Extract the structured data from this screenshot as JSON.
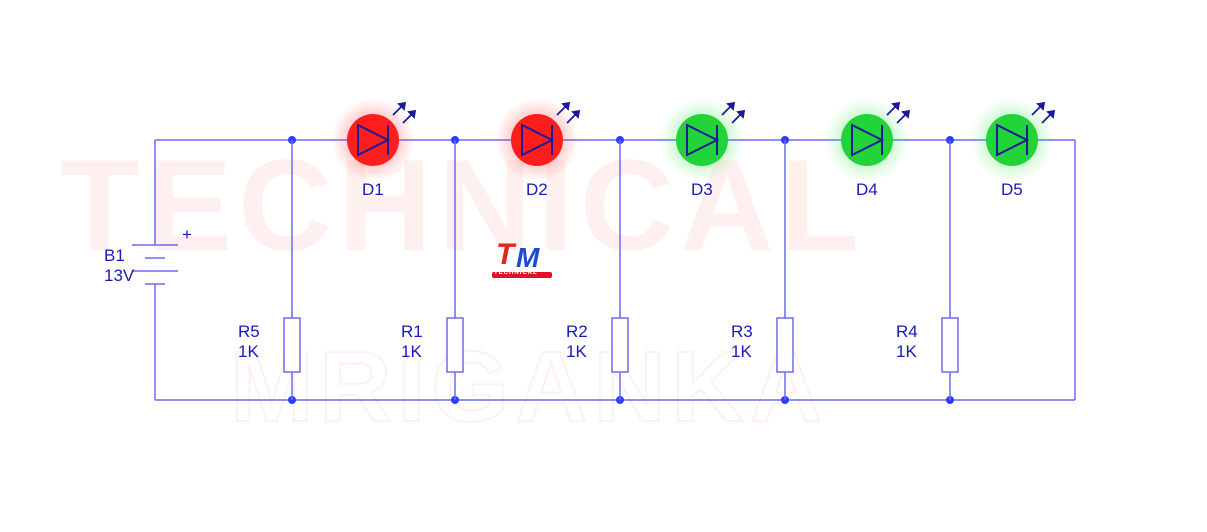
{
  "colors": {
    "wire": "#6c6cf0",
    "label": "#1a1ab8",
    "node": "#2e3cff",
    "redLed": "#ff1e1e",
    "greenLed": "#22d43a",
    "arrow": "#1b1b98"
  },
  "battery": {
    "ref": "B1",
    "value": "13V",
    "plus": "+"
  },
  "leds": [
    {
      "ref": "D1",
      "color": "red"
    },
    {
      "ref": "D2",
      "color": "red"
    },
    {
      "ref": "D3",
      "color": "green"
    },
    {
      "ref": "D4",
      "color": "green"
    },
    {
      "ref": "D5",
      "color": "green"
    }
  ],
  "resistors": [
    {
      "ref": "R5",
      "value": "1K"
    },
    {
      "ref": "R1",
      "value": "1K"
    },
    {
      "ref": "R2",
      "value": "1K"
    },
    {
      "ref": "R3",
      "value": "1K"
    },
    {
      "ref": "R4",
      "value": "1K"
    }
  ],
  "watermark": {
    "line1": "TECHNICAL",
    "line2": "MRIGANKA"
  },
  "logo": {
    "t": "T",
    "m": "M",
    "sub": "TECHNICAL"
  }
}
